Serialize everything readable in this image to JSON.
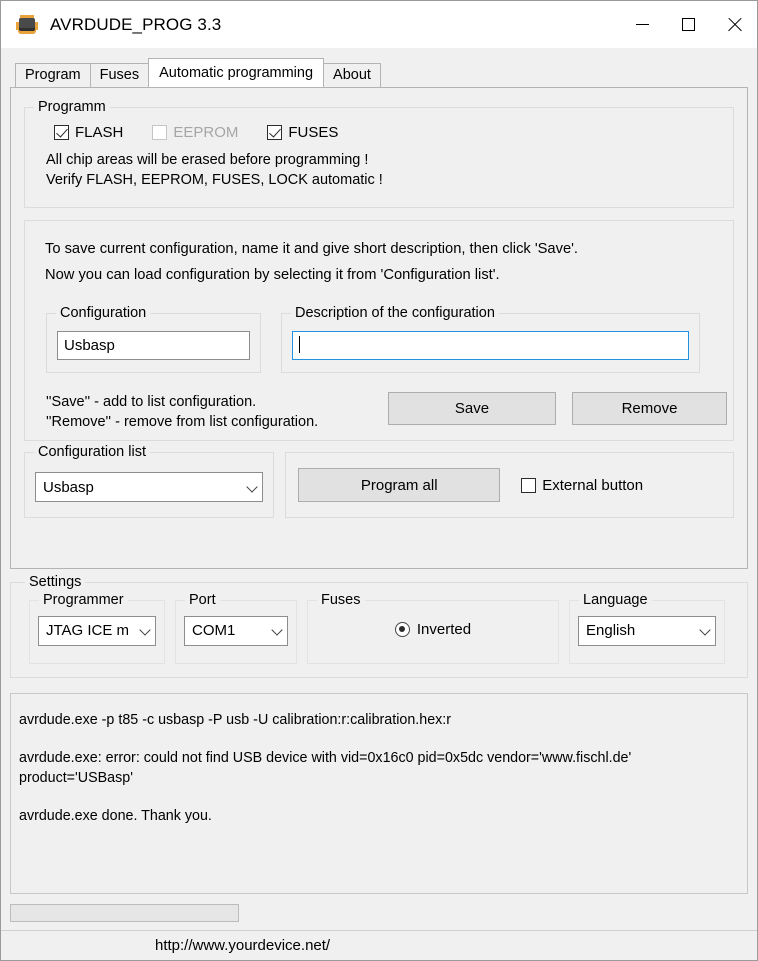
{
  "window": {
    "title": "AVRDUDE_PROG 3.3",
    "icon": "microchip-icon",
    "controls": {
      "minimize": "minimize-icon",
      "maximize": "maximize-icon",
      "close": "close-icon"
    }
  },
  "tabs": [
    {
      "label": "Program",
      "active": false
    },
    {
      "label": "Fuses",
      "active": false
    },
    {
      "label": "Automatic programming",
      "active": true
    },
    {
      "label": "About",
      "active": false
    }
  ],
  "programm": {
    "group_label": "Programm",
    "checkboxes": [
      {
        "label": "FLASH",
        "checked": true,
        "disabled": false
      },
      {
        "label": "EEPROM",
        "checked": false,
        "disabled": true
      },
      {
        "label": "FUSES",
        "checked": true,
        "disabled": false
      }
    ],
    "note_line1": "All chip areas will be erased before programming !",
    "note_line2": "Verify FLASH, EEPROM, FUSES, LOCK automatic !"
  },
  "configuration": {
    "help_line1": "To save current configuration, name it and give short description, then click 'Save'.",
    "help_line2": "Now you can load configuration by selecting it from 'Configuration list'.",
    "name_group_label": "Configuration",
    "name_value": "Usbasp",
    "desc_group_label": "Description of the configuration",
    "desc_value": "",
    "desc_placeholder": "",
    "btn_note_line1": "''Save'' - add to list configuration.",
    "btn_note_line2": "''Remove'' - remove from list configuration.",
    "save_label": "Save",
    "remove_label": "Remove"
  },
  "configuration_list": {
    "group_label": "Configuration list",
    "selected": "Usbasp",
    "options": [
      "Usbasp"
    ],
    "program_all_label": "Program all",
    "external_button_label": "External button",
    "external_button_checked": false
  },
  "settings": {
    "group_label": "Settings",
    "programmer": {
      "label": "Programmer",
      "selected": "JTAG ICE m",
      "options": [
        "JTAG ICE m"
      ]
    },
    "port": {
      "label": "Port",
      "selected": "COM1",
      "options": [
        "COM1"
      ]
    },
    "fuses": {
      "label": "Fuses",
      "radio_label": "Inverted",
      "radio_selected": true
    },
    "language": {
      "label": "Language",
      "selected": "English",
      "options": [
        "English"
      ]
    }
  },
  "console": {
    "lines": [
      "avrdude.exe -p t85 -c usbasp -P usb -U calibration:r:calibration.hex:r",
      "avrdude.exe: error: could not find USB device with vid=0x16c0 pid=0x5dc vendor='www.fischl.de' product='USBasp'",
      "avrdude.exe done.  Thank you."
    ]
  },
  "progress": {
    "value": 0
  },
  "statusbar": {
    "url": "http://www.yourdevice.net/"
  },
  "colors": {
    "focus_border": "#2291e0",
    "face": "#f0f0f0",
    "button_face": "#e1e1e1",
    "disabled_text": "#a6a6a6"
  }
}
